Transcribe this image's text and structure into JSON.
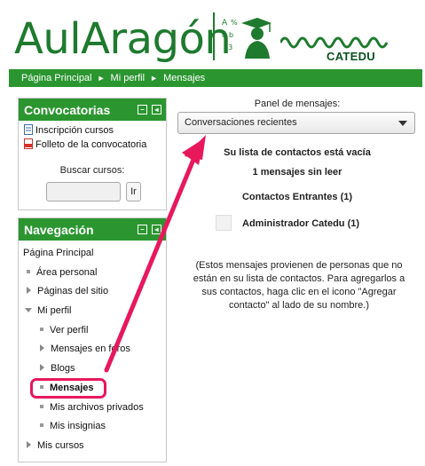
{
  "brand": {
    "logo_text": "AulAragón",
    "partner": "CATEDU",
    "colors": {
      "primary": "#2b9630",
      "logo": "#1e7a2e",
      "highlight": "#e8185c"
    }
  },
  "breadcrumb": {
    "items": [
      "Página Principal",
      "Mi perfil",
      "Mensajes"
    ],
    "separator": "►"
  },
  "convocatorias": {
    "title": "Convocatorias",
    "links": [
      "Inscripción cursos",
      "Folleto de la convocatoria"
    ],
    "search_label": "Buscar cursos:",
    "search_value": "",
    "go_label": "Ir"
  },
  "navegacion": {
    "title": "Navegación",
    "home": "Página Principal",
    "area_personal": "Área personal",
    "paginas_sitio": "Páginas del sitio",
    "mi_perfil": "Mi perfil",
    "ver_perfil": "Ver perfil",
    "mensajes_foros": "Mensajes en foros",
    "blogs": "Blogs",
    "mensajes": "Mensajes",
    "archivos": "Mis archivos privados",
    "insignias": "Mis insignias",
    "mis_cursos": "Mis cursos"
  },
  "main": {
    "panel_label": "Panel de mensajes:",
    "select_value": "Conversaciones recientes",
    "empty_contacts": "Su lista de contactos está vacía",
    "unread": "1 mensajes sin leer",
    "incoming": "Contactos Entrantes (1)",
    "contact": "Administrador Catedu (1)",
    "info": "(Estos mensajes provienen de personas que no están en su lista de contactos. Para agregarlos a sus contactos, haga clic en el icono \"Agregar contacto\" al lado de su nombre.)"
  },
  "icons": [
    "minimize-icon",
    "dock-icon",
    "document-icon",
    "pdf-icon",
    "dropdown-arrow-icon",
    "graduate-icon",
    "wave-icon"
  ]
}
